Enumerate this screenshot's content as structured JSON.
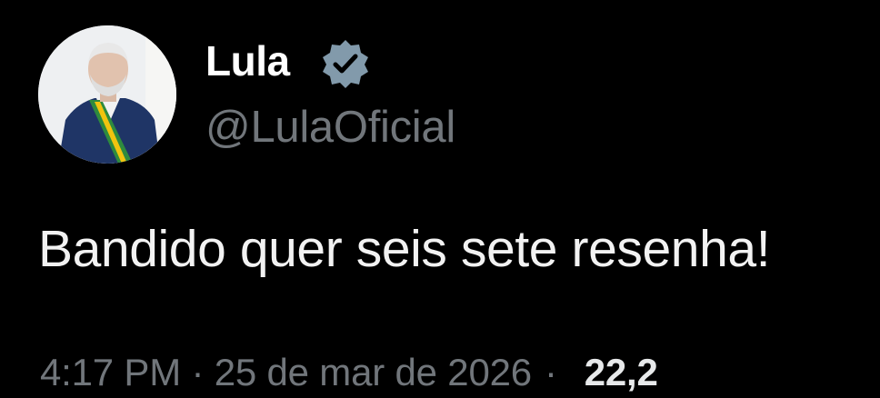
{
  "author": {
    "display_name": "Lula",
    "handle": "@LulaOficial",
    "verified_icon": "verified-badge-icon",
    "badge_color": "#829aab"
  },
  "post": {
    "text": "Bandido quer seis sete resenha!",
    "timestamp": "4:17 PM · 25 de mar de 2026",
    "views": "22,2"
  },
  "colors": {
    "background": "#000000",
    "primary_text": "#e7e9ea",
    "secondary_text": "#71767b"
  }
}
